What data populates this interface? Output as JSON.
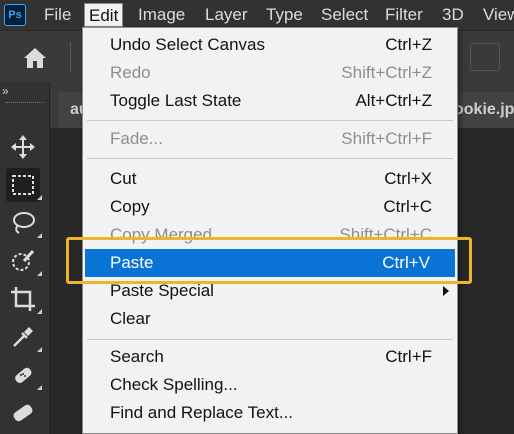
{
  "app": {
    "logo_text": "Ps"
  },
  "menubar": {
    "items": [
      {
        "label": "File"
      },
      {
        "label": "Edit"
      },
      {
        "label": "Image"
      },
      {
        "label": "Layer"
      },
      {
        "label": "Type"
      },
      {
        "label": "Select"
      },
      {
        "label": "Filter"
      },
      {
        "label": "3D"
      },
      {
        "label": "View"
      }
    ],
    "active": "Edit"
  },
  "toolbar": {
    "collapse_label": "»",
    "tools": [
      {
        "icon": "move-icon"
      },
      {
        "icon": "rectangular-marquee-icon",
        "selected": true
      },
      {
        "icon": "lasso-icon"
      },
      {
        "icon": "quick-selection-icon"
      },
      {
        "icon": "crop-icon"
      },
      {
        "icon": "eyedropper-icon"
      },
      {
        "icon": "healing-brush-icon"
      },
      {
        "icon": "bandage-icon"
      }
    ]
  },
  "document": {
    "tabs": [
      {
        "label": "au"
      },
      {
        "label": "ookie.jp"
      }
    ]
  },
  "edit_menu": {
    "items": [
      {
        "label": "Undo Select Canvas",
        "shortcut": "Ctrl+Z",
        "disabled": false
      },
      {
        "label": "Redo",
        "shortcut": "Shift+Ctrl+Z",
        "disabled": true
      },
      {
        "label": "Toggle Last State",
        "shortcut": "Alt+Ctrl+Z",
        "disabled": false
      },
      {
        "label": "Fade...",
        "shortcut": "Shift+Ctrl+F",
        "disabled": true
      },
      {
        "label": "Cut",
        "shortcut": "Ctrl+X",
        "disabled": false
      },
      {
        "label": "Copy",
        "shortcut": "Ctrl+C",
        "disabled": false
      },
      {
        "label": "Copy Merged",
        "shortcut": "Shift+Ctrl+C",
        "disabled": true
      },
      {
        "label": "Paste",
        "shortcut": "Ctrl+V",
        "disabled": false,
        "highlighted": true
      },
      {
        "label": "Paste Special",
        "shortcut": "",
        "disabled": false,
        "submenu": true
      },
      {
        "label": "Clear",
        "shortcut": "",
        "disabled": false
      },
      {
        "label": "Search",
        "shortcut": "Ctrl+F",
        "disabled": false
      },
      {
        "label": "Check Spelling...",
        "shortcut": "",
        "disabled": false
      },
      {
        "label": "Find and Replace Text...",
        "shortcut": "",
        "disabled": false
      }
    ]
  },
  "colors": {
    "highlight": "#0a74d6",
    "annotation": "#f0b429",
    "menu_bg": "#f2f2f2",
    "ui_dark": "#323232"
  }
}
